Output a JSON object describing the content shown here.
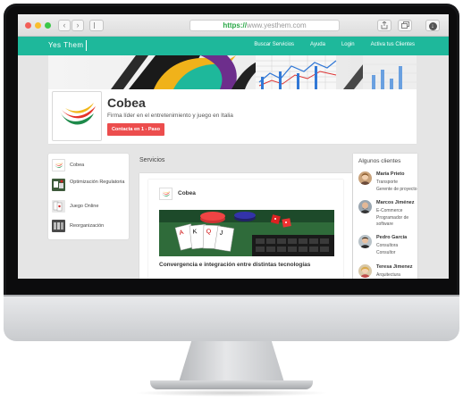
{
  "browser": {
    "url_protocol": "https://",
    "url_host": "www.yesthem.com"
  },
  "site_nav": {
    "brand": "Yes Them",
    "links": [
      "Buscar Servicios",
      "Ayuda",
      "Login",
      "Activa tus Clientes"
    ]
  },
  "company": {
    "name": "Cobea",
    "tagline": "Firma líder en el entretenimiento y juego en Italia",
    "contact_button": "Contacta en 1 - Paso"
  },
  "sidebar": {
    "items": [
      {
        "label": "Cobea"
      },
      {
        "label": "Optimización Regulatoria"
      },
      {
        "label": "Juego Online"
      },
      {
        "label": "Reorganización"
      }
    ]
  },
  "services": {
    "title": "Servicios",
    "card_company": "Cobea",
    "caption": "Convergencia e integración entre distintas tecnologías"
  },
  "clients": {
    "title": "Algunos clientes",
    "items": [
      {
        "name": "María Prieto",
        "line1": "Transporte",
        "line2": "Gerente de proyecto"
      },
      {
        "name": "Marcos Jiménez",
        "line1": "E-Commerce",
        "line2": "Programador de",
        "line3": "software"
      },
      {
        "name": "Pedro García",
        "line1": "Consultora",
        "line2": "Consultor"
      },
      {
        "name": "Teresa Jimenez",
        "line1": "Arquitectura"
      }
    ]
  },
  "colors": {
    "nav": "#1eb89b",
    "contact_button": "#ec4d4d"
  }
}
